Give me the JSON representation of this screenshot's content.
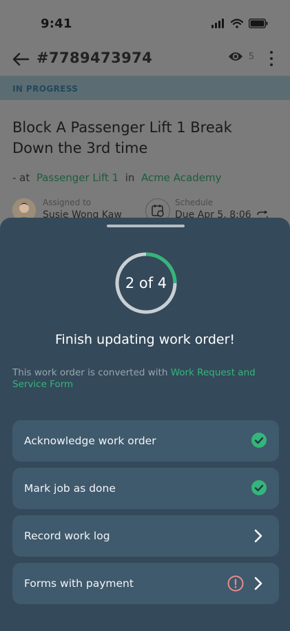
{
  "status": {
    "time": "9:41"
  },
  "header": {
    "work_order_id": "#7789473974",
    "viewers_count": "5"
  },
  "status_band": {
    "label": "IN PROGRESS"
  },
  "work_order": {
    "title": "Block A Passenger Lift 1 Break Down the 3rd time",
    "location": {
      "prefix": "- at",
      "asset": "Passenger Lift 1",
      "in": "in",
      "site": "Acme Academy"
    },
    "assigned_to": {
      "label": "Assigned to",
      "value": "Susie Wong Kaw"
    },
    "schedule": {
      "label": "Schedule",
      "value": "Due Apr 5, 8:06"
    }
  },
  "sheet": {
    "progress": {
      "completed": 2,
      "total": 4,
      "text": "2 of 4"
    },
    "title": "Finish updating work order!",
    "note": {
      "prefix": "This work order is converted with ",
      "link": "Work Request and Service Form"
    },
    "actions": [
      {
        "label": "Acknowledge work order",
        "state": "done"
      },
      {
        "label": "Mark job as done",
        "state": "done"
      },
      {
        "label": "Record work log",
        "state": "pending"
      },
      {
        "label": "Forms with payment",
        "state": "warning"
      }
    ]
  },
  "colors": {
    "sheet_bg": "#34495a",
    "card_bg": "#3f596d",
    "success": "#35b57a",
    "warning": "#e88c8c",
    "ring_track": "#c9cfd4"
  }
}
